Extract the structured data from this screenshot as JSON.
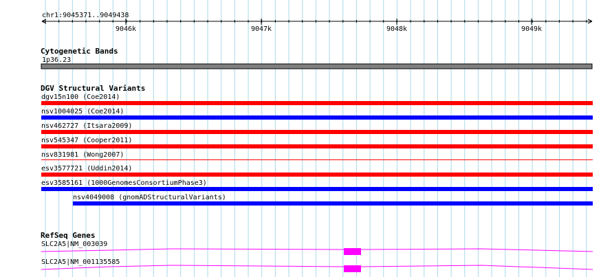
{
  "location": "chr1:9045371..9049438",
  "ruler": {
    "ticks": [
      "9046k",
      "9047k",
      "9048k",
      "9049k"
    ]
  },
  "tracks": {
    "cytoband": {
      "title": "Cytogenetic Bands",
      "band_label": "1p36.23",
      "color": "#808080"
    },
    "dgv": {
      "title": "DGV Structural Variants",
      "features": [
        {
          "label": "dgv15n100 (Coe2014)",
          "color": "#ff0000"
        },
        {
          "label": "nsv1004025 (Coe2014)",
          "color": "#0000ff"
        },
        {
          "label": "nsv462727 (Itsara2009)",
          "color": "#ff0000"
        },
        {
          "label": "nsv545347 (Cooper2011)",
          "color": "#ff0000"
        },
        {
          "label": "nsv831981 (Wong2007)",
          "color": "#ff0000"
        },
        {
          "label": "esv3577721 (Uddin2014)",
          "color": "#ff0000"
        },
        {
          "label": "esv3585161 (1000GenomesConsortiumPhase3)",
          "color": "#0000ff"
        },
        {
          "label": "nsv4049008 (gnomADStructuralVariants)",
          "color": "#0000ff"
        }
      ]
    },
    "refseq": {
      "title": "RefSeq Genes",
      "color": "#ff00ff",
      "transcripts": [
        {
          "label": "SLC2A5|NM_003039"
        },
        {
          "label": "SLC2A5|NM_001135585"
        }
      ]
    }
  },
  "colors": {
    "grid_line": "#a8d8e8",
    "ruler": "#000000"
  }
}
